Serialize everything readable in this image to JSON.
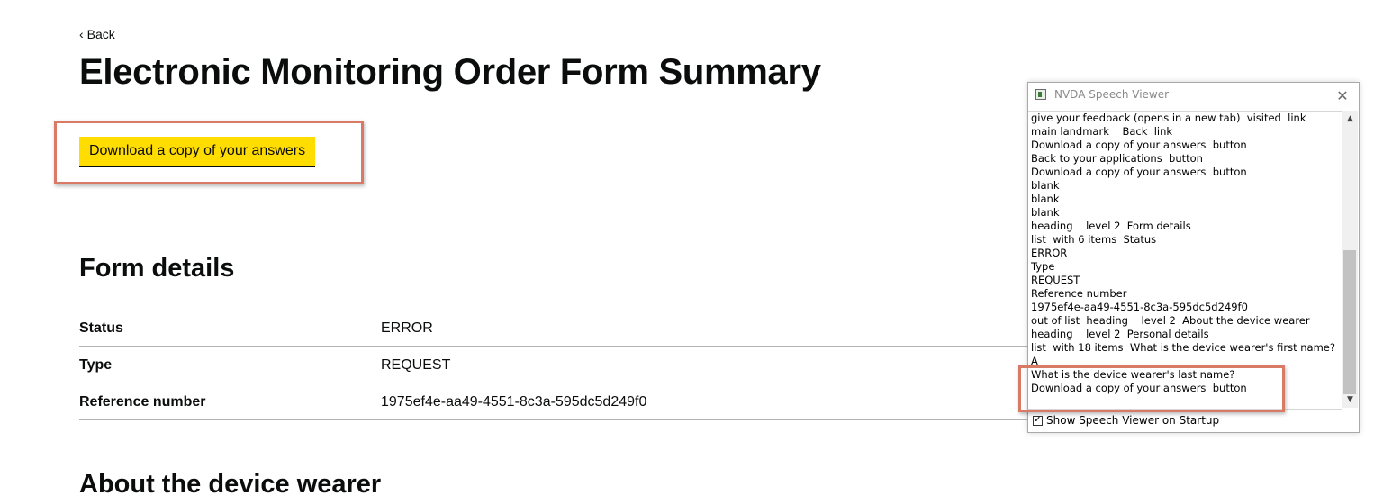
{
  "back_link": {
    "label": "Back"
  },
  "page_title": "Electronic Monitoring Order Form Summary",
  "download_button_label": "Download a copy of your answers",
  "form_details": {
    "heading": "Form details",
    "rows": [
      {
        "key": "Status",
        "value": "ERROR"
      },
      {
        "key": "Type",
        "value": "REQUEST"
      },
      {
        "key": "Reference number",
        "value": "1975ef4e-aa49-4551-8c3a-595dc5d249f0"
      }
    ]
  },
  "about_heading": "About the device wearer",
  "highlight_color": "#d97a66",
  "button_color": "#ffdd00",
  "nvda": {
    "title": "NVDA Speech Viewer",
    "close_icon": "close-icon",
    "lines": [
      "give your feedback (opens in a new tab)  visited  link",
      "main landmark    Back  link",
      "Download a copy of your answers  button",
      "Back to your applications  button",
      "Download a copy of your answers  button",
      "blank",
      "blank",
      "blank",
      "heading    level 2  Form details",
      "list  with 6 items  Status",
      "ERROR",
      "Type",
      "REQUEST",
      "Reference number",
      "1975ef4e-aa49-4551-8c3a-595dc5d249f0",
      "out of list  heading    level 2  About the device wearer",
      "heading    level 2  Personal details",
      "list  with 18 items  What is the device wearer's first name?",
      "A",
      "What is the device wearer's last name?",
      "Download a copy of your answers  button"
    ],
    "show_on_startup_label": "Show Speech Viewer on Startup",
    "show_on_startup_checked": true
  }
}
